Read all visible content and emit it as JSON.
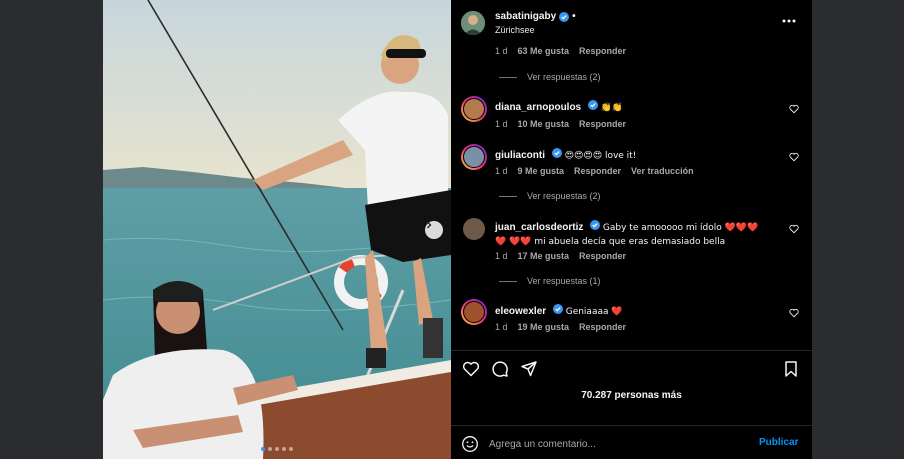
{
  "post": {
    "author": "sabatinigaby",
    "location": "Zürichsee",
    "header_separator": "•"
  },
  "comments": [
    {
      "user": "",
      "text": "",
      "age": "1 d",
      "likes": "63 Me gusta",
      "reply": "Responder",
      "view_replies": "Ver respuestas (2)"
    },
    {
      "user": "diana_arnopoulos",
      "text": "👏👏",
      "age": "1 d",
      "likes": "10 Me gusta",
      "reply": "Responder",
      "avatar_color": "#b37a4c"
    },
    {
      "user": "giuliaconti",
      "text": "😍😍😍😍 love it!",
      "age": "1 d",
      "likes": "9 Me gusta",
      "reply": "Responder",
      "translate": "Ver traducción",
      "view_replies": "Ver respuestas (2)",
      "avatar_color": "#7b8fa6"
    },
    {
      "user": "juan_carlosdeortiz",
      "text": "Gaby te amooooo mi ídolo ❤️❤️❤️❤️ ❤️❤️ mi abuela decía que eras demasiado bella",
      "age": "1 d",
      "likes": "17 Me gusta",
      "reply": "Responder",
      "view_replies": "Ver respuestas (1)",
      "avatar_color": "#6f5a4a"
    },
    {
      "user": "eleowexler",
      "text": "Geniaaaa ❤️",
      "age": "1 d",
      "likes": "19 Me gusta",
      "reply": "Responder",
      "avatar_color": "#a0522d"
    }
  ],
  "likes_summary": "70.287 personas más",
  "composer": {
    "placeholder": "Agrega un comentario...",
    "publish_label": "Publicar"
  },
  "icons": {
    "like": "heart-icon",
    "comment": "comment-icon",
    "share": "share-icon",
    "save": "bookmark-icon",
    "more": "more-options-icon",
    "emoji": "emoji-icon",
    "next": "chevron-right-icon"
  },
  "colors": {
    "accent": "#0095f6",
    "verified": "#3897f0",
    "heart": "#ff3040"
  }
}
